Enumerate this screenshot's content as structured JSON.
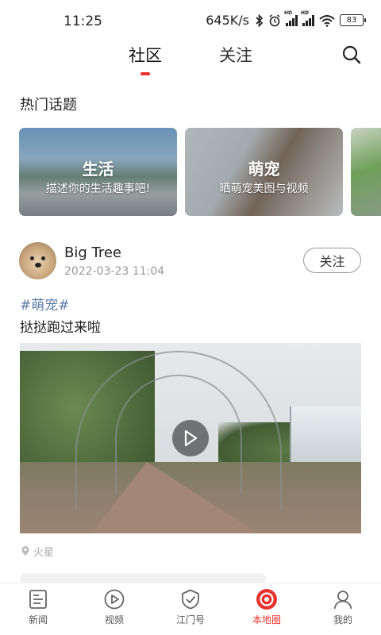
{
  "status_bar": {
    "time": "11:25",
    "network_speed": "645K/s",
    "battery": "83"
  },
  "top_nav": {
    "tabs": [
      {
        "label": "社区",
        "active": true
      },
      {
        "label": "关注",
        "active": false
      }
    ],
    "accent_color": "#e8322d"
  },
  "hot_topics": {
    "title": "热门话题",
    "cards": [
      {
        "title": "生活",
        "subtitle": "描述你的生活趣事吧!"
      },
      {
        "title": "萌宠",
        "subtitle": "晒萌宠美图与视频"
      }
    ]
  },
  "post": {
    "author": "Big Tree",
    "time": "2022-03-23 11:04",
    "follow_label": "关注",
    "hashtag": "#萌宠#",
    "text": "挞挞跑过来啦",
    "location": "火星"
  },
  "bottom_nav": {
    "items": [
      {
        "label": "新闻",
        "icon": "news-icon"
      },
      {
        "label": "视频",
        "icon": "video-play-icon"
      },
      {
        "label": "江门号",
        "icon": "checkmark-icon"
      },
      {
        "label": "本地圈",
        "icon": "local-circle-icon",
        "active": true
      },
      {
        "label": "我的",
        "icon": "profile-icon"
      }
    ]
  }
}
